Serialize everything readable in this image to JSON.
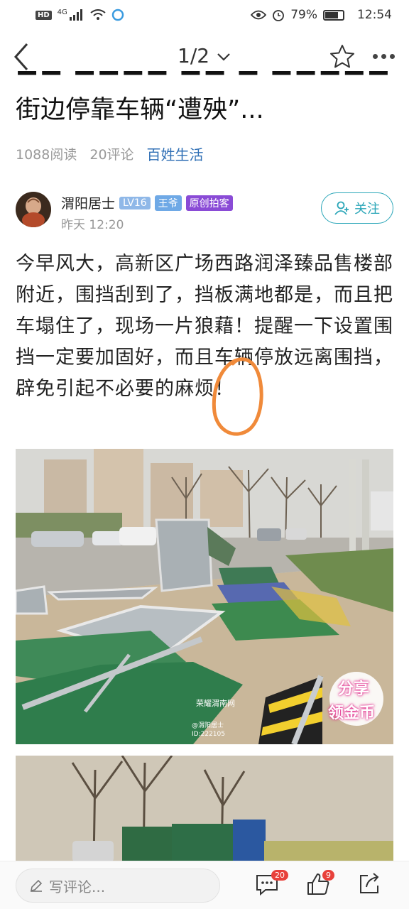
{
  "status_bar": {
    "network_badge": "HD",
    "network_type": "4G",
    "battery_percent": "79%",
    "battery_level": 0.79,
    "time": "12:54",
    "icons": [
      "signal-icon",
      "wifi-icon",
      "app-notify-icon",
      "eye-icon",
      "alarm-icon",
      "battery-icon"
    ]
  },
  "nav": {
    "page_indicator": "1/2",
    "icons": [
      "back-arrow-icon",
      "chevron-down-icon",
      "star-icon",
      "more-dots-icon"
    ]
  },
  "article": {
    "title": "街边停靠车辆“遭殃”...",
    "reads": "1088阅读",
    "comments": "20评论",
    "category": "百姓生活"
  },
  "author": {
    "name": "渭阳居士",
    "level_badge": "LV16",
    "title_badge": "王爷",
    "role_badge": "原创拍客",
    "post_time": "昨天 12:20",
    "follow_label": "关注"
  },
  "body": {
    "text": " 今早风大，高新区广场西路润泽臻品售楼部附近，围挡刮到了，挡板满地都是，而且把车塌住了，现场一片狼藉！提醒一下设置围挡一定要加固好，而且车辆停放远离围挡，辟免引起不必要的麻烦！"
  },
  "photos": {
    "watermark_site": "荣耀渭南网",
    "credit_user": "@渭阳居士",
    "credit_id": "ID:222105",
    "share_badge_line1": "分享",
    "share_badge_line2": "领金币"
  },
  "bottom_bar": {
    "comment_placeholder": "写评论...",
    "comment_count": "20",
    "like_count": "9",
    "icons": [
      "pencil-icon",
      "comment-icon",
      "like-icon",
      "share-icon"
    ]
  },
  "colors": {
    "accent": "#2aa6b8",
    "category_link": "#2f6fb5",
    "annotation_circle": "#f08a3a",
    "badge_purple": "#8a4bd6",
    "badge_red": "#e8413b"
  }
}
